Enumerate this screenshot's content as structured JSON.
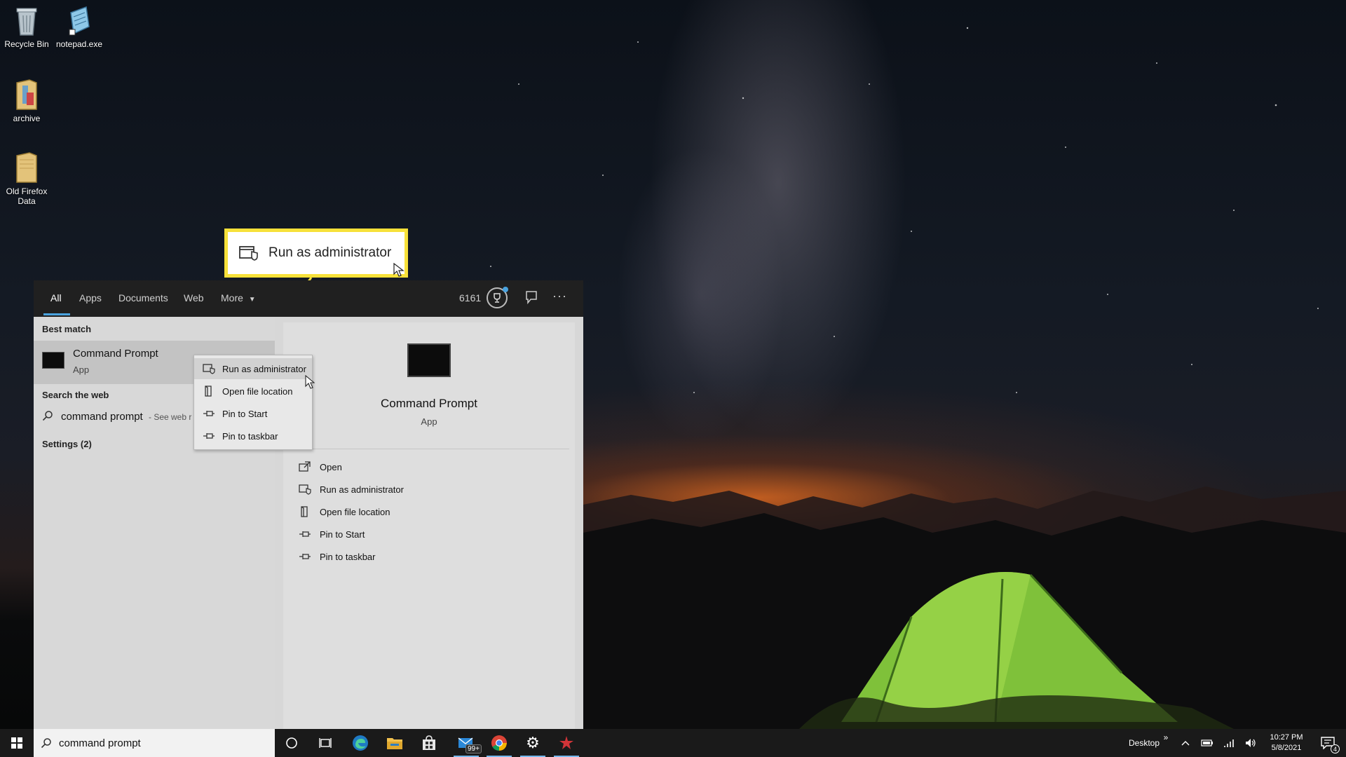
{
  "desktop": {
    "icons": [
      {
        "label": "Recycle Bin",
        "icon": "recycle-bin-icon"
      },
      {
        "label": "notepad.exe",
        "icon": "notepad-icon"
      },
      {
        "label": "archive",
        "icon": "folder-icon"
      },
      {
        "label": "Old Firefox Data",
        "icon": "folder-icon"
      }
    ]
  },
  "callout": {
    "label": "Run as administrator",
    "icon": "shield-run-icon",
    "color": "#f7e13a"
  },
  "search_panel": {
    "tabs": [
      {
        "label": "All",
        "active": true
      },
      {
        "label": "Apps"
      },
      {
        "label": "Documents"
      },
      {
        "label": "Web"
      },
      {
        "label": "More"
      }
    ],
    "points": "6161",
    "best_match": {
      "section_title": "Best match",
      "name": "Command Prompt",
      "type": "App"
    },
    "search_web": {
      "section_title": "Search the web",
      "query": "command prompt",
      "suffix": "- See web r"
    },
    "settings": {
      "label": "Settings (2)"
    },
    "context_menu": [
      {
        "label": "Run as administrator",
        "icon": "shield-run-icon"
      },
      {
        "label": "Open file location",
        "icon": "file-location-icon"
      },
      {
        "label": "Pin to Start",
        "icon": "pin-icon"
      },
      {
        "label": "Pin to taskbar",
        "icon": "pin-icon"
      }
    ],
    "preview": {
      "name": "Command Prompt",
      "type": "App",
      "actions": [
        {
          "label": "Open",
          "icon": "open-icon"
        },
        {
          "label": "Run as administrator",
          "icon": "shield-run-icon"
        },
        {
          "label": "Open file location",
          "icon": "file-location-icon"
        },
        {
          "label": "Pin to Start",
          "icon": "pin-icon"
        },
        {
          "label": "Pin to taskbar",
          "icon": "pin-icon"
        }
      ]
    }
  },
  "taskbar": {
    "search_value": "command prompt",
    "mail_badge": "99+",
    "desktop_label": "Desktop",
    "toolbar_chevron": "»",
    "time": "10:27 PM",
    "date": "5/8/2021",
    "notification_count": "4",
    "accent_color": "#76b9ed"
  }
}
